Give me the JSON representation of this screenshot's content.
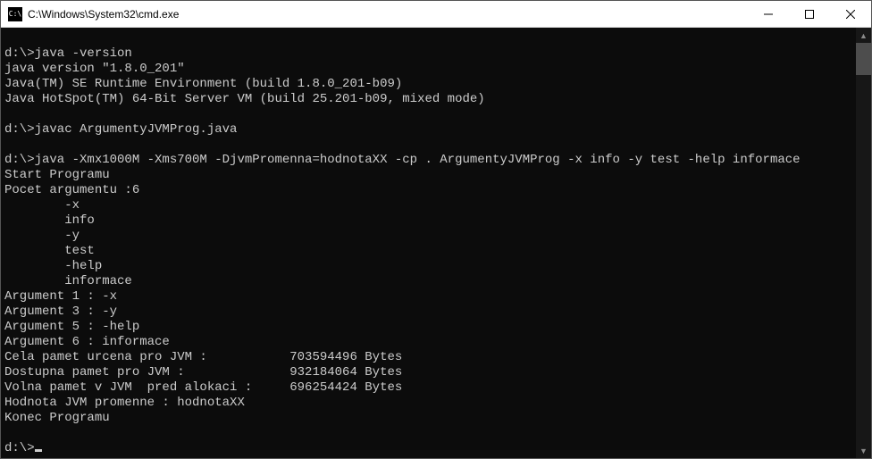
{
  "window": {
    "title": "C:\\Windows\\System32\\cmd.exe",
    "icon_label": "cmd-icon"
  },
  "prompt": "d:\\>",
  "lines": [
    "",
    "d:\\>java -version",
    "java version \"1.8.0_201\"",
    "Java(TM) SE Runtime Environment (build 1.8.0_201-b09)",
    "Java HotSpot(TM) 64-Bit Server VM (build 25.201-b09, mixed mode)",
    "",
    "d:\\>javac ArgumentyJVMProg.java",
    "",
    "d:\\>java -Xmx1000M -Xms700M -DjvmPromenna=hodnotaXX -cp . ArgumentyJVMProg -x info -y test -help informace",
    "Start Programu",
    "Pocet argumentu :6",
    "        -x",
    "        info",
    "        -y",
    "        test",
    "        -help",
    "        informace",
    "Argument 1 : -x",
    "Argument 3 : -y",
    "Argument 5 : -help",
    "Argument 6 : informace",
    "Cela pamet urcena pro JVM :           703594496 Bytes",
    "Dostupna pamet pro JVM :              932184064 Bytes",
    "Volna pamet v JVM  pred alokaci :     696254424 Bytes",
    "Hodnota JVM promenne : hodnotaXX",
    "Konec Programu",
    "",
    "d:\\>"
  ],
  "titlebar_buttons": {
    "minimize": "minimize",
    "maximize": "maximize",
    "close": "close"
  },
  "icon_glyph": "C:\\"
}
